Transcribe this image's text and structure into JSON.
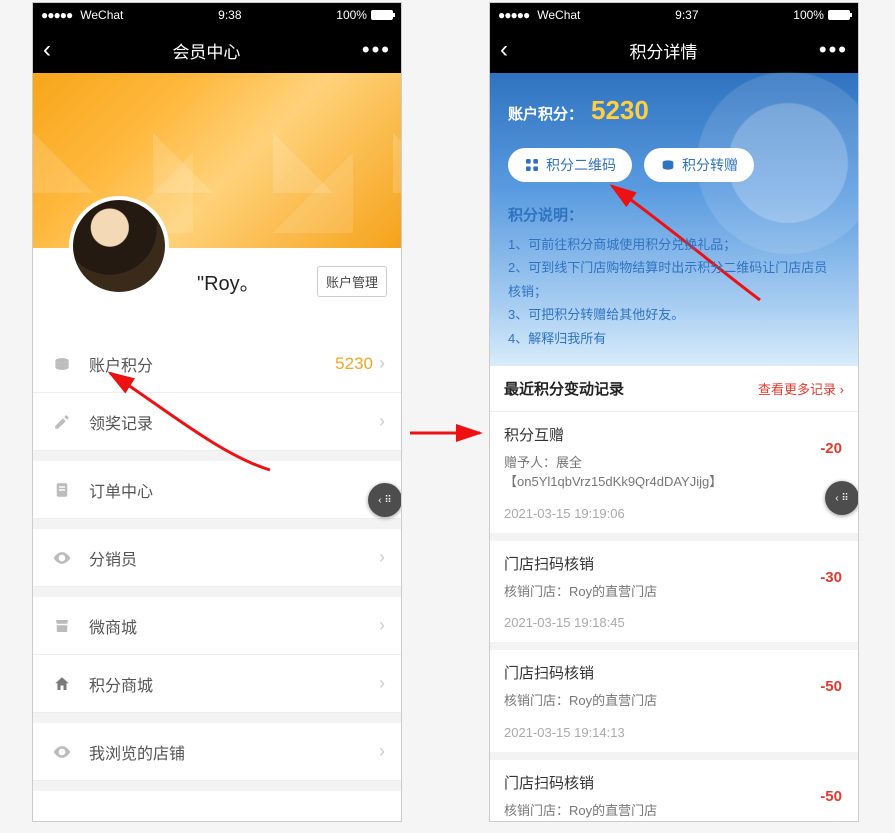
{
  "left": {
    "status": {
      "carrier": "WeChat",
      "time": "9:38",
      "battery": "100%"
    },
    "title": "会员中心",
    "username": "\"Roy。",
    "account_manage_btn": "账户管理",
    "menu": [
      {
        "icon": "coin",
        "label": "账户积分",
        "value": "5230"
      },
      {
        "icon": "pencil",
        "label": "领奖记录",
        "value": ""
      },
      {
        "icon": "doc",
        "label": "订单中心",
        "value": ""
      },
      {
        "icon": "eye",
        "label": "分销员",
        "value": ""
      },
      {
        "icon": "shop",
        "label": "微商城",
        "value": ""
      },
      {
        "icon": "home",
        "label": "积分商城",
        "value": ""
      },
      {
        "icon": "eye",
        "label": "我浏览的店铺",
        "value": ""
      }
    ]
  },
  "right": {
    "status": {
      "carrier": "WeChat",
      "time": "9:37",
      "battery": "100%"
    },
    "title": "积分详情",
    "points_label": "账户积分：",
    "points_value": "5230",
    "pill_qr": "积分二维码",
    "pill_gift": "积分转赠",
    "explain_title": "积分说明：",
    "explain_items": [
      "1、可前往积分商城使用积分兑换礼品；",
      "2、可到线下门店购物结算时出示积分二维码让门店店员核销；",
      "3、可把积分转赠给其他好友。",
      "4、解释归我所有"
    ],
    "section_title": "最近积分变动记录",
    "more_link": "查看更多记录 ›",
    "records": [
      {
        "title": "积分互赠",
        "sub": "赠予人：展全【on5Yl1qbVrz15dKk9Qr4dDAYJijg】",
        "time": "2021-03-15 19:19:06",
        "amount": "-20"
      },
      {
        "title": "门店扫码核销",
        "sub": "核销门店：Roy的直营门店",
        "time": "2021-03-15 19:18:45",
        "amount": "-30"
      },
      {
        "title": "门店扫码核销",
        "sub": "核销门店：Roy的直营门店",
        "time": "2021-03-15 19:14:13",
        "amount": "-50"
      },
      {
        "title": "门店扫码核销",
        "sub": "核销门店：Roy的直营门店",
        "time": "",
        "amount": "-50"
      }
    ]
  },
  "float_label": "‹ ⠿"
}
